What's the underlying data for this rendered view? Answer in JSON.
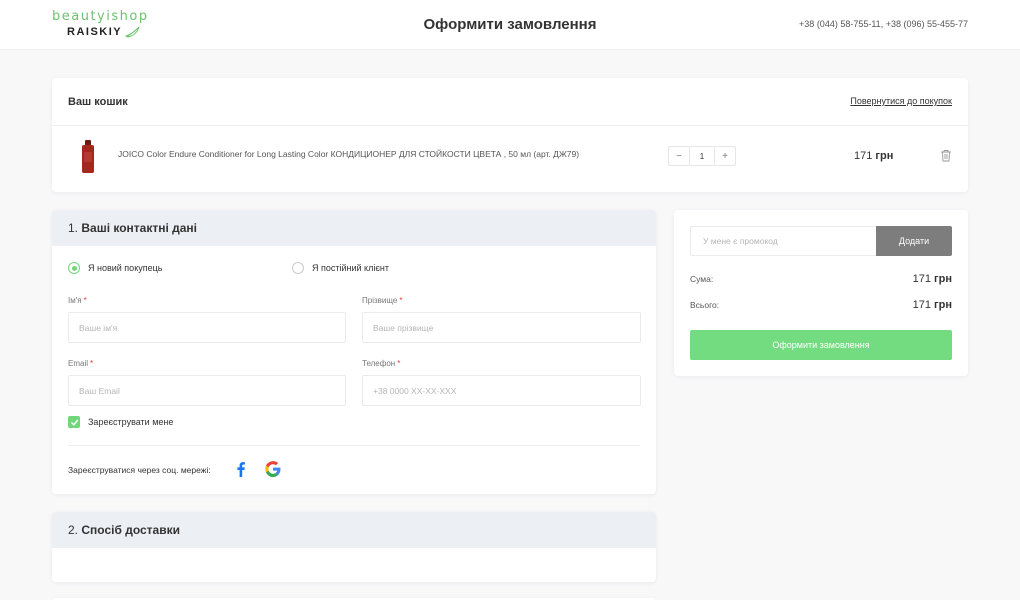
{
  "header": {
    "logo_top": "beautyishop",
    "logo_bottom": "RAISKIY",
    "title": "Оформити замовлення",
    "phones": "+38 (044) 58-755-11, +38 (096) 55-455-77"
  },
  "cart": {
    "title": "Ваш кошик",
    "back_link": "Повернутися до покупок",
    "items": [
      {
        "name": "JOICO Color Endure Conditioner for Long Lasting Color КОНДИЦИОНЕР ДЛЯ СТОЙКОСТИ ЦВЕТА , 50 мл (арт. ДЖ79)",
        "qty_minus": "−",
        "qty": "1",
        "qty_plus": "+",
        "price": "171",
        "currency": "грн"
      }
    ]
  },
  "contacts": {
    "number": "1.",
    "title": "Ваші контактні дані",
    "radio_new": "Я новий покупець",
    "radio_existing": "Я постійний клієнт",
    "name_label": "Ім'я",
    "name_placeholder": "Ваше ім'я",
    "surname_label": "Прізвище",
    "surname_placeholder": "Ваше прізвище",
    "email_label": "Email",
    "email_placeholder": "Ваш Email",
    "phone_label": "Телефон",
    "phone_placeholder": "+38 0000 XX-XX-XXX",
    "required_mark": "*",
    "register_label": "Зареєструвати мене",
    "social_label": "Зареєструватися через соц. мережі:"
  },
  "delivery": {
    "number": "2.",
    "title": "Спосіб доставки"
  },
  "summary": {
    "promo_placeholder": "У мене є промокод",
    "promo_button": "Додати",
    "sum_label": "Сума:",
    "sum_value": "171",
    "total_label": "Всього:",
    "total_value": "171",
    "currency": "грн",
    "order_button": "Оформити замовлення"
  },
  "colors": {
    "accent_green": "#74dc80",
    "brand_green": "#6cc36f",
    "facebook_blue": "#1877f2",
    "promo_button_gray": "#7d7d7d",
    "section_header_bg": "#eceff3"
  },
  "icons": [
    "leaf-icon",
    "product-bottle-icon",
    "trash-icon",
    "checkmark-icon",
    "facebook-icon",
    "google-icon"
  ]
}
